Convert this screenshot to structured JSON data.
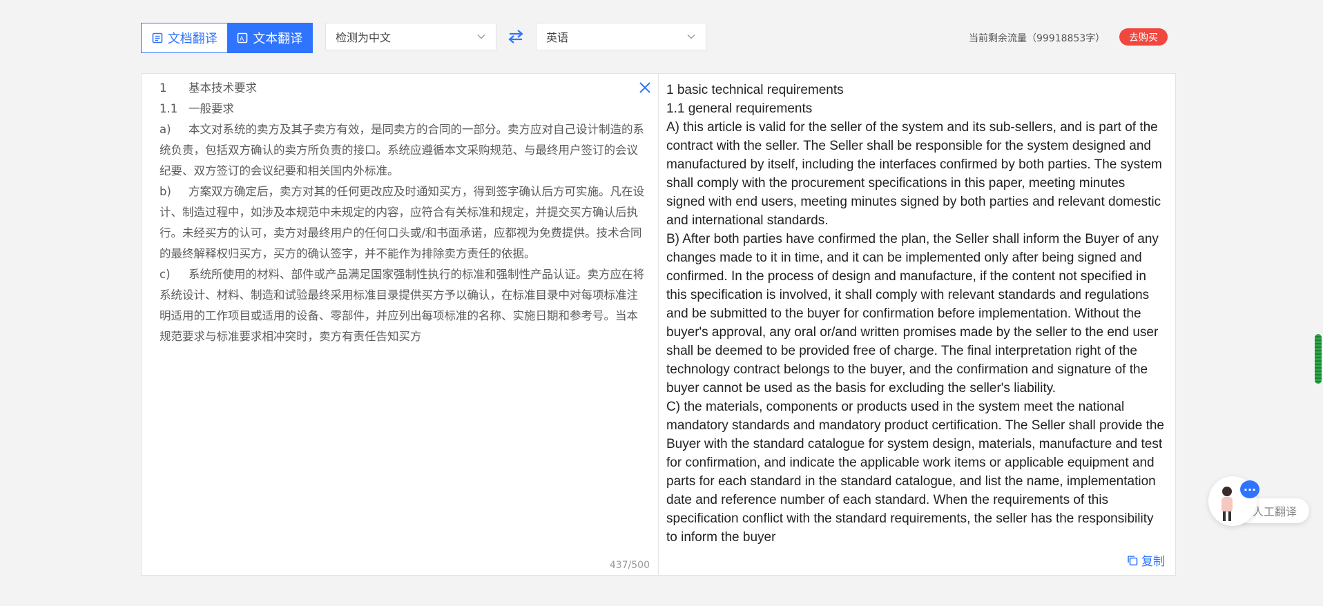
{
  "toolbar": {
    "doc_translate_label": "文档翻译",
    "text_translate_label": "文本翻译",
    "source_lang": "检测为中文",
    "target_lang": "英语",
    "quota_text": "当前剩余流量（99918853字）",
    "buy_label": "去购买"
  },
  "source": {
    "text": "1\t基本技术要求\n1.1\t一般要求\na)\t本文对系统的卖方及其子卖方有效，是同卖方的合同的一部分。卖方应对自己设计制造的系统负责，包括双方确认的卖方所负责的接口。系统应遵循本文采购规范、与最终用户签订的会议纪要、双方签订的会议纪要和相关国内外标准。\nb)\t方案双方确定后，卖方对其的任何更改应及时通知买方，得到签字确认后方可实施。凡在设计、制造过程中，如涉及本规范中未规定的内容，应符合有关标准和规定，并提交买方确认后执行。未经买方的认可，卖方对最终用户的任何口头或/和书面承诺，应都视为免费提供。技术合同的最终解释权归买方，买方的确认签字，并不能作为排除卖方责任的依据。\nc)\t系统所使用的材料、部件或产品满足国家强制性执行的标准和强制性产品认证。卖方应在将系统设计、材料、制造和试验最终采用标准目录提供买方予以确认，在标准目录中对每项标准注明适用的工作项目或适用的设备、零部件，并应列出每项标准的名称、实施日期和参考号。当本规范要求与标准要求相冲突时，卖方有责任告知买方",
    "counter": "437/500"
  },
  "output": {
    "text": "1 basic technical requirements\n1.1 general requirements\nA) this article is valid for the seller of the system and its sub-sellers, and is part of the contract with the seller. The Seller shall be responsible for the system designed and manufactured by itself, including the interfaces confirmed by both parties. The system shall comply with the procurement specifications in this paper, meeting minutes signed with end users, meeting minutes signed by both parties and relevant domestic and international standards.\nB) After both parties have confirmed the plan, the Seller shall inform the Buyer of any changes made to it in time, and it can be implemented only after being signed and confirmed. In the process of design and manufacture, if the content not specified in this specification is involved, it shall comply with relevant standards and regulations and be submitted to the buyer for confirmation before implementation. Without the buyer's approval, any oral or/and written promises made by the seller to the end user shall be deemed to be provided free of charge. The final interpretation right of the technology contract belongs to the buyer, and the confirmation and signature of the buyer cannot be used as the basis for excluding the seller's liability.\nC) the materials, components or products used in the system meet the national mandatory standards and mandatory product certification. The Seller shall provide the Buyer with the standard catalogue for system design, materials, manufacture and test for confirmation, and indicate the applicable work items or applicable equipment and parts for each standard in the standard catalogue, and list the name, implementation date and reference number of each standard. When the requirements of this specification conflict with the standard requirements, the seller has the responsibility to inform the buyer",
    "copy_label": "复制"
  },
  "widget": {
    "human_translate_label": "人工翻译"
  },
  "colors": {
    "accent": "#2f74ff",
    "buy": "#f0473f"
  }
}
